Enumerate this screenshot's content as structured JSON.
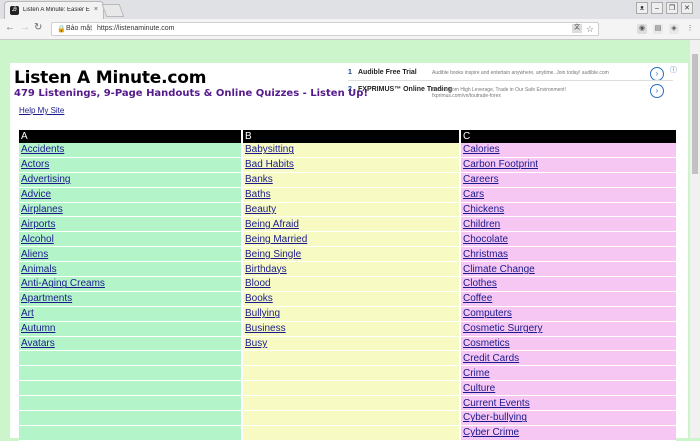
{
  "browser": {
    "tab_title": "Listen A Minute: Easier E",
    "tab_close": "×",
    "favicon": "Ꭿ",
    "security_label": "Bảo mật",
    "url": "https://listenaminute.com",
    "window_buttons": [
      "ᴥ",
      "–",
      "❐",
      "✕"
    ]
  },
  "site": {
    "title": "Listen A Minute.com",
    "tagline": "479 Listenings, 9-Page Handouts & Online Quizzes - Listen Up!",
    "help_link": "Help My Site"
  },
  "ads": [
    {
      "number": "1",
      "title": "Audible Free Trial",
      "description": "Audible books inspire and entertain anywhere, anytime. Join today! audible.com"
    },
    {
      "number": "2",
      "title": "FXPRIMUS™ Online Trading",
      "description": "Benefit from High Leverage, Trade in Our Safe Environment! fxprimus.com/vn/toutrade-forex"
    }
  ],
  "table": {
    "headers": [
      "A",
      "B",
      "C"
    ],
    "columns": [
      [
        "Accidents",
        "Actors",
        "Advertising",
        "Advice",
        "Airplanes",
        "Airports",
        "Alcohol",
        "Aliens",
        "Animals",
        "Anti-Aging Creams",
        "Apartments",
        "Art",
        "Autumn",
        "Avatars"
      ],
      [
        "Babysitting",
        "Bad Habits",
        "Banks",
        "Baths",
        "Beauty",
        "Being Afraid",
        "Being Married",
        "Being Single",
        "Birthdays",
        "Blood",
        "Books",
        "Bullying",
        "Business",
        "Busy"
      ],
      [
        "Calories",
        "Carbon Footprint",
        "Careers",
        "Cars",
        "Chickens",
        "Children",
        "Chocolate",
        "Christmas",
        "Climate Change",
        "Clothes",
        "Coffee",
        "Computers",
        "Cosmetic Surgery",
        "Cosmetics",
        "Credit Cards",
        "Crime",
        "Culture",
        "Current Events",
        "Cyber-bullying",
        "Cyber Crime"
      ]
    ]
  }
}
